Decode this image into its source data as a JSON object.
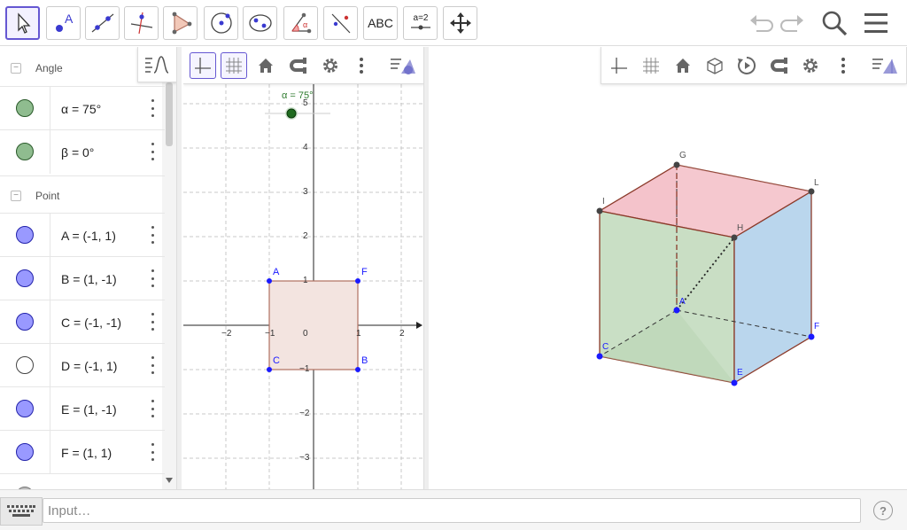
{
  "toolbar": {
    "tools": [
      {
        "name": "move-tool",
        "icon": "cursor-arrow-icon"
      },
      {
        "name": "point-tool",
        "icon": "point-icon",
        "label": "A"
      },
      {
        "name": "line-tool",
        "icon": "line-through-points-icon"
      },
      {
        "name": "perpendicular-line-tool",
        "icon": "perpendicular-line-icon"
      },
      {
        "name": "polygon-tool",
        "icon": "polygon-icon"
      },
      {
        "name": "circle-tool",
        "icon": "circle-center-point-icon"
      },
      {
        "name": "conic-tool",
        "icon": "ellipse-icon"
      },
      {
        "name": "angle-tool",
        "icon": "angle-icon",
        "label": "α"
      },
      {
        "name": "reflect-tool",
        "icon": "reflect-about-line-icon"
      },
      {
        "name": "text-tool",
        "icon": "text-icon",
        "label": "ABC"
      },
      {
        "name": "slider-tool",
        "icon": "slider-icon",
        "label": "a=2"
      },
      {
        "name": "move-graphics-tool",
        "icon": "move-arrows-icon"
      }
    ],
    "undo_icon": "undo-icon",
    "redo_icon": "redo-icon",
    "search_icon": "search-icon",
    "menu_icon": "hamburger-menu-icon"
  },
  "algebra": {
    "groups": [
      {
        "label": "Angle",
        "items": [
          {
            "def": "α = 75°",
            "color": "#8fbc8f",
            "filled": true
          },
          {
            "def": "β = 0°",
            "color": "#8fbc8f",
            "filled": true
          }
        ]
      },
      {
        "label": "Point",
        "items": [
          {
            "def": "A = (-1, 1)",
            "color": "#9999ff",
            "filled": true
          },
          {
            "def": "B = (1, -1)",
            "color": "#9999ff",
            "filled": true
          },
          {
            "def": "C = (-1, -1)",
            "color": "#9999ff",
            "filled": true
          },
          {
            "def": "D = (-1, 1)",
            "color": "#ffffff",
            "filled": false
          },
          {
            "def": "E = (1, -1)",
            "color": "#9999ff",
            "filled": true
          },
          {
            "def": "F = (1, 1)",
            "color": "#9999ff",
            "filled": true
          }
        ]
      }
    ]
  },
  "graphics2d": {
    "slider_label": "α = 75°",
    "x_ticks": [
      "−2",
      "−1",
      "0",
      "1",
      "2"
    ],
    "y_ticks": [
      "5",
      "4",
      "3",
      "2",
      "1",
      "−1",
      "−2",
      "−3"
    ],
    "points": {
      "A": "A",
      "F": "F",
      "C": "C",
      "B": "B"
    },
    "square_fill": "#f3e4e0",
    "square_stroke": "#b07060"
  },
  "graphics3d": {
    "vertex_labels": {
      "G": "G",
      "L": "L",
      "I": "I",
      "H": "H",
      "A": "A",
      "F": "F",
      "C": "C",
      "E": "E"
    },
    "colors": {
      "top": "#f2b8c2",
      "left": "#c3dcbf",
      "right": "#b6d4ec",
      "edge": "#8b3a2a",
      "point_blue": "#1a1aff",
      "point_dark": "#444444"
    }
  },
  "inputbar": {
    "placeholder": "Input…",
    "help_label": "?"
  },
  "accent_color": "#6557d2"
}
